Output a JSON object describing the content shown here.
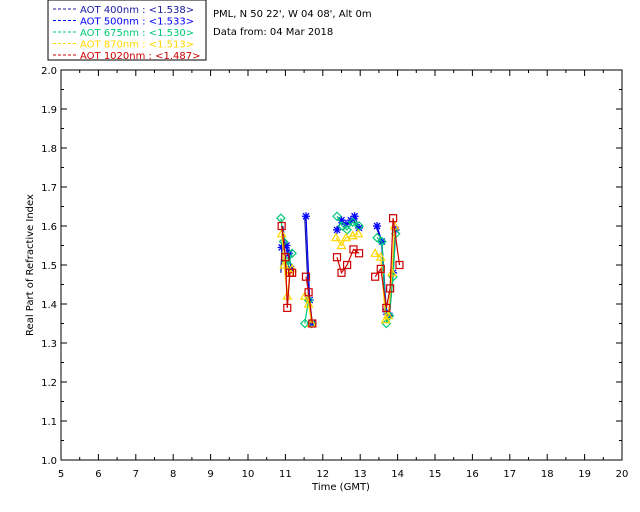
{
  "legend": [
    {
      "text": "AOT  400nm : <1.538>",
      "color": "#1a1a9e"
    },
    {
      "text": "AOT  500nm : <1.533>",
      "color": "#0000ff"
    },
    {
      "text": "AOT  675nm : <1.530>",
      "color": "#00c878"
    },
    {
      "text": "AOT  870nm : <1.513>",
      "color": "#ffd700"
    },
    {
      "text": "AOT 1020nm : <1.487>",
      "color": "#cc0000"
    }
  ],
  "site_info": "PML, N 50 22', W 04 08', Alt 0m",
  "date_info": "Data from: 04 Mar 2018",
  "chart_data": {
    "type": "line",
    "xlabel": "Time (GMT)",
    "ylabel": "Real Part of Refractive Index",
    "xlim": [
      5,
      20
    ],
    "ylim": [
      1.0,
      2.0
    ],
    "xticks": [
      5,
      6,
      7,
      8,
      9,
      10,
      11,
      12,
      13,
      14,
      15,
      16,
      17,
      18,
      19,
      20
    ],
    "yticks": [
      "1.0",
      "1.1",
      "1.2",
      "1.3",
      "1.4",
      "1.5",
      "1.6",
      "1.7",
      "1.8",
      "1.9",
      "2.0"
    ],
    "grid": false,
    "series": [
      {
        "name": "AOT  400nm",
        "color": "#1a1a9e",
        "marker": "none",
        "segments": [
          [
            [
              10.88,
              1.48
            ],
            [
              10.93,
              1.6
            ],
            [
              11.0,
              1.55
            ],
            [
              11.08,
              1.52
            ],
            [
              11.15,
              1.5
            ]
          ],
          [
            [
              11.52,
              1.62
            ],
            [
              11.62,
              1.41
            ],
            [
              11.7,
              1.35
            ]
          ],
          [
            [
              12.35,
              1.59
            ],
            [
              12.5,
              1.61
            ],
            [
              12.62,
              1.6
            ],
            [
              12.8,
              1.62
            ],
            [
              12.95,
              1.59
            ]
          ],
          [
            [
              13.42,
              1.6
            ],
            [
              13.57,
              1.56
            ],
            [
              13.68,
              1.38
            ],
            [
              13.75,
              1.37
            ],
            [
              13.85,
              1.48
            ],
            [
              13.95,
              1.59
            ]
          ]
        ]
      },
      {
        "name": "AOT  500nm",
        "color": "#0000ff",
        "marker": "asterisk",
        "segments": [
          [
            [
              10.9,
              1.545
            ],
            [
              10.97,
              1.55
            ],
            [
              11.03,
              1.55
            ],
            [
              11.1,
              1.53
            ],
            [
              11.15,
              1.49
            ]
          ],
          [
            [
              11.55,
              1.625
            ],
            [
              11.65,
              1.41
            ],
            [
              11.72,
              1.35
            ]
          ],
          [
            [
              12.38,
              1.59
            ],
            [
              12.5,
              1.615
            ],
            [
              12.62,
              1.605
            ],
            [
              12.75,
              1.615
            ],
            [
              12.85,
              1.625
            ],
            [
              12.97,
              1.595
            ]
          ],
          [
            [
              13.45,
              1.6
            ],
            [
              13.58,
              1.56
            ],
            [
              13.7,
              1.38
            ],
            [
              13.78,
              1.37
            ],
            [
              13.88,
              1.48
            ],
            [
              13.95,
              1.59
            ]
          ]
        ]
      },
      {
        "name": "AOT  675nm",
        "color": "#00c878",
        "marker": "diamond",
        "segments": [
          [
            [
              10.88,
              1.62
            ],
            [
              10.95,
              1.56
            ],
            [
              11.02,
              1.51
            ],
            [
              11.08,
              1.5
            ],
            [
              11.18,
              1.53
            ]
          ],
          [
            [
              11.52,
              1.35
            ],
            [
              11.62,
              1.41
            ],
            [
              11.7,
              1.35
            ]
          ],
          [
            [
              12.38,
              1.625
            ],
            [
              12.52,
              1.6
            ],
            [
              12.65,
              1.59
            ],
            [
              12.8,
              1.61
            ],
            [
              12.97,
              1.6
            ]
          ],
          [
            [
              13.45,
              1.57
            ],
            [
              13.58,
              1.56
            ],
            [
              13.7,
              1.35
            ],
            [
              13.78,
              1.37
            ],
            [
              13.88,
              1.47
            ],
            [
              13.95,
              1.58
            ]
          ]
        ]
      },
      {
        "name": "AOT  870nm",
        "color": "#ffd700",
        "marker": "triangle",
        "segments": [
          [
            [
              10.9,
              1.58
            ],
            [
              10.97,
              1.5
            ],
            [
              11.05,
              1.42
            ],
            [
              11.12,
              1.48
            ],
            [
              11.18,
              1.49
            ]
          ],
          [
            [
              11.52,
              1.42
            ],
            [
              11.62,
              1.4
            ],
            [
              11.7,
              1.35
            ]
          ],
          [
            [
              12.35,
              1.57
            ],
            [
              12.5,
              1.55
            ],
            [
              12.62,
              1.57
            ],
            [
              12.8,
              1.575
            ],
            [
              12.95,
              1.58
            ]
          ],
          [
            [
              13.4,
              1.53
            ],
            [
              13.55,
              1.52
            ],
            [
              13.68,
              1.36
            ],
            [
              13.75,
              1.37
            ],
            [
              13.85,
              1.48
            ],
            [
              13.92,
              1.6
            ]
          ]
        ]
      },
      {
        "name": "AOT 1020nm",
        "color": "#cc0000",
        "marker": "square",
        "segments": [
          [
            [
              10.9,
              1.6
            ],
            [
              11.0,
              1.52
            ],
            [
              11.05,
              1.39
            ],
            [
              11.12,
              1.48
            ],
            [
              11.18,
              1.48
            ]
          ],
          [
            [
              11.55,
              1.47
            ],
            [
              11.62,
              1.43
            ],
            [
              11.72,
              1.35
            ]
          ],
          [
            [
              12.38,
              1.52
            ],
            [
              12.5,
              1.48
            ],
            [
              12.65,
              1.5
            ],
            [
              12.82,
              1.54
            ],
            [
              12.97,
              1.53
            ]
          ],
          [
            [
              13.4,
              1.47
            ],
            [
              13.55,
              1.49
            ],
            [
              13.7,
              1.39
            ],
            [
              13.8,
              1.44
            ],
            [
              13.88,
              1.62
            ],
            [
              14.05,
              1.5
            ]
          ]
        ]
      }
    ]
  }
}
